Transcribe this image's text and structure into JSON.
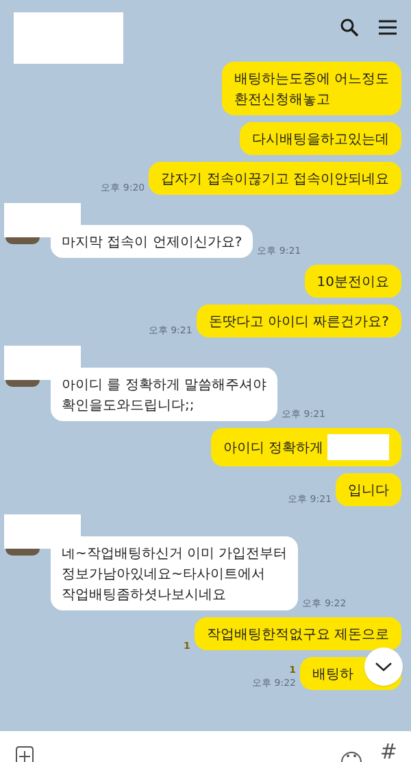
{
  "header": {
    "title_redacted": true
  },
  "messages": [
    {
      "kind": "sent",
      "text": "배팅하는도중에 어느정도\n환전신청해놓고"
    },
    {
      "kind": "sent",
      "text": "다시배팅을하고있는데"
    },
    {
      "kind": "sent",
      "text": "갑자기 접속이끊기고 접속이안되네요",
      "time": "오후 9:20"
    },
    {
      "kind": "received",
      "text": "마지막 접속이 언제이신가요?",
      "time": "오후 9:21"
    },
    {
      "kind": "sent",
      "text": "10분전이요"
    },
    {
      "kind": "sent",
      "text": "돈땃다고 아이디 짜른건가요?",
      "time": "오후 9:21"
    },
    {
      "kind": "received",
      "text": "아이디 를 정확하게 말씀해주셔야\n확인을도와드립니다;;",
      "time": "오후 9:21"
    },
    {
      "kind": "sent",
      "text": "아이디 정확하게",
      "redacted_tail": true
    },
    {
      "kind": "sent",
      "text": "입니다",
      "time": "오후 9:21"
    },
    {
      "kind": "received",
      "text": "네~작업배팅하신거 이미 가입전부터\n정보가남아있네요~타사이트에서\n작업배팅좀하셧나보시네요",
      "time": "오후 9:22"
    },
    {
      "kind": "sent",
      "text": "작업배팅한적없구요 제돈으로",
      "unread": "1"
    },
    {
      "kind": "sent",
      "text": "배팅하",
      "unread": "1",
      "time": "오후 9:22",
      "covered": true
    }
  ],
  "input_bar": {
    "hashtag": "#"
  }
}
